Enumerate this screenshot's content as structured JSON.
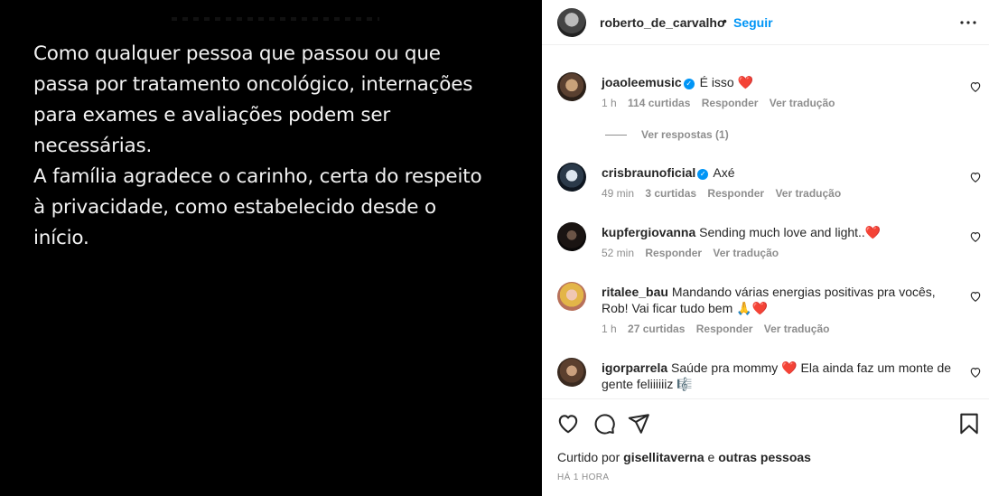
{
  "post": {
    "caption_image_text": "Como qualquer pessoa que passou ou que\npassa por tratamento oncológico, internações\npara exames e avaliações podem ser\nnecessárias.\nA família agradece o carinho, certa do respeito\nà privacidade, como estabelecido desde o\ninício."
  },
  "header": {
    "username": "roberto_de_carvalho",
    "separator": "•",
    "follow_label": "Seguir",
    "more_icon": "more-horizontal-icon"
  },
  "comments": [
    {
      "username": "joaoleemusic",
      "verified": true,
      "text": "É isso",
      "emoji": "❤️",
      "time": "1 h",
      "likes": "114 curtidas",
      "reply": "Responder",
      "translate": "Ver tradução",
      "view_replies": "Ver respostas (1)"
    },
    {
      "username": "crisbraunoficial",
      "verified": true,
      "text": "Axé",
      "time": "49 min",
      "likes": "3 curtidas",
      "reply": "Responder",
      "translate": "Ver tradução"
    },
    {
      "username": "kupfergiovanna",
      "verified": false,
      "text": "Sending much love and light..",
      "emoji": "❤️",
      "time": "52 min",
      "reply": "Responder",
      "translate": "Ver tradução"
    },
    {
      "username": "ritalee_bau",
      "verified": false,
      "text": "Mandando várias energias positivas pra vocês, Rob! Vai ficar tudo bem",
      "emoji": "🙏❤️",
      "time": "1 h",
      "likes": "27 curtidas",
      "reply": "Responder",
      "translate": "Ver tradução"
    },
    {
      "username": "igorparrela",
      "verified": false,
      "text_before": "Saúde pra mommy",
      "emoji_mid": "❤️",
      "text_after": "Ela ainda faz um monte de gente feliiiiiiz",
      "emoji_end": "🎼"
    }
  ],
  "actions": {
    "icons": [
      "heart-icon",
      "comment-icon",
      "share-icon",
      "bookmark-icon"
    ],
    "liked_prefix": "Curtido por",
    "liked_user": "gisellitaverna",
    "liked_conj": "e",
    "liked_suffix": "outras pessoas",
    "timestamp": "HÁ 1 HORA"
  },
  "colors": {
    "accent": "#0095f6",
    "heart": "#ed4956",
    "muted": "#8e8e8e",
    "image_bg": "#000000"
  }
}
